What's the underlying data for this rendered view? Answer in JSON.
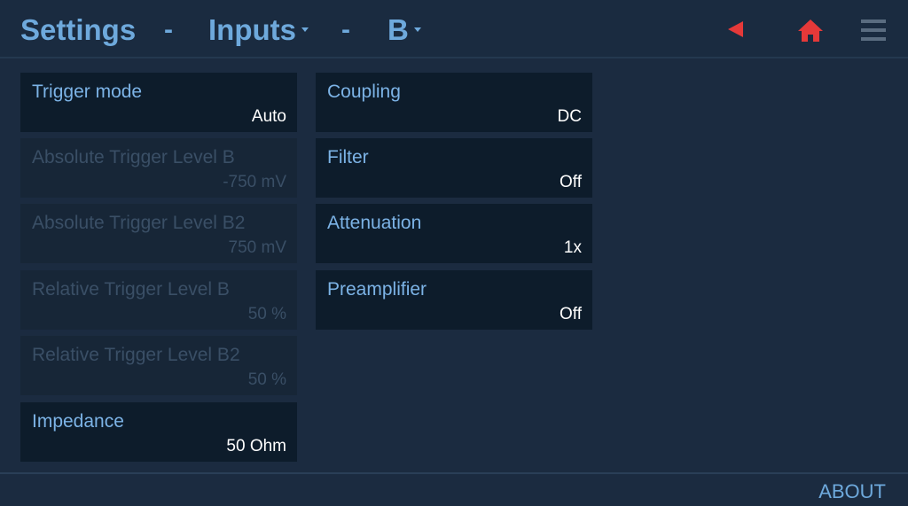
{
  "header": {
    "title": "Settings",
    "separator": "-",
    "section": "Inputs",
    "channel": "B",
    "icons": {
      "back": "back-triangle-icon",
      "home": "home-icon",
      "menu": "hamburger-menu-icon"
    },
    "accent_color": "#e53939"
  },
  "left_column": [
    {
      "label": "Trigger mode",
      "value": "Auto",
      "enabled": true
    },
    {
      "label": "Absolute Trigger Level B",
      "value": "-750 mV",
      "enabled": false
    },
    {
      "label": "Absolute Trigger Level B2",
      "value": "750 mV",
      "enabled": false
    },
    {
      "label": "Relative Trigger Level B",
      "value": "50 %",
      "enabled": false
    },
    {
      "label": "Relative Trigger Level B2",
      "value": "50 %",
      "enabled": false
    },
    {
      "label": "Impedance",
      "value": "50 Ohm",
      "enabled": true
    }
  ],
  "right_column": [
    {
      "label": "Coupling",
      "value": "DC",
      "enabled": true
    },
    {
      "label": "Filter",
      "value": "Off",
      "enabled": true
    },
    {
      "label": "Attenuation",
      "value": "1x",
      "enabled": true
    },
    {
      "label": "Preamplifier",
      "value": "Off",
      "enabled": true
    }
  ],
  "footer": {
    "about_label": "ABOUT"
  }
}
